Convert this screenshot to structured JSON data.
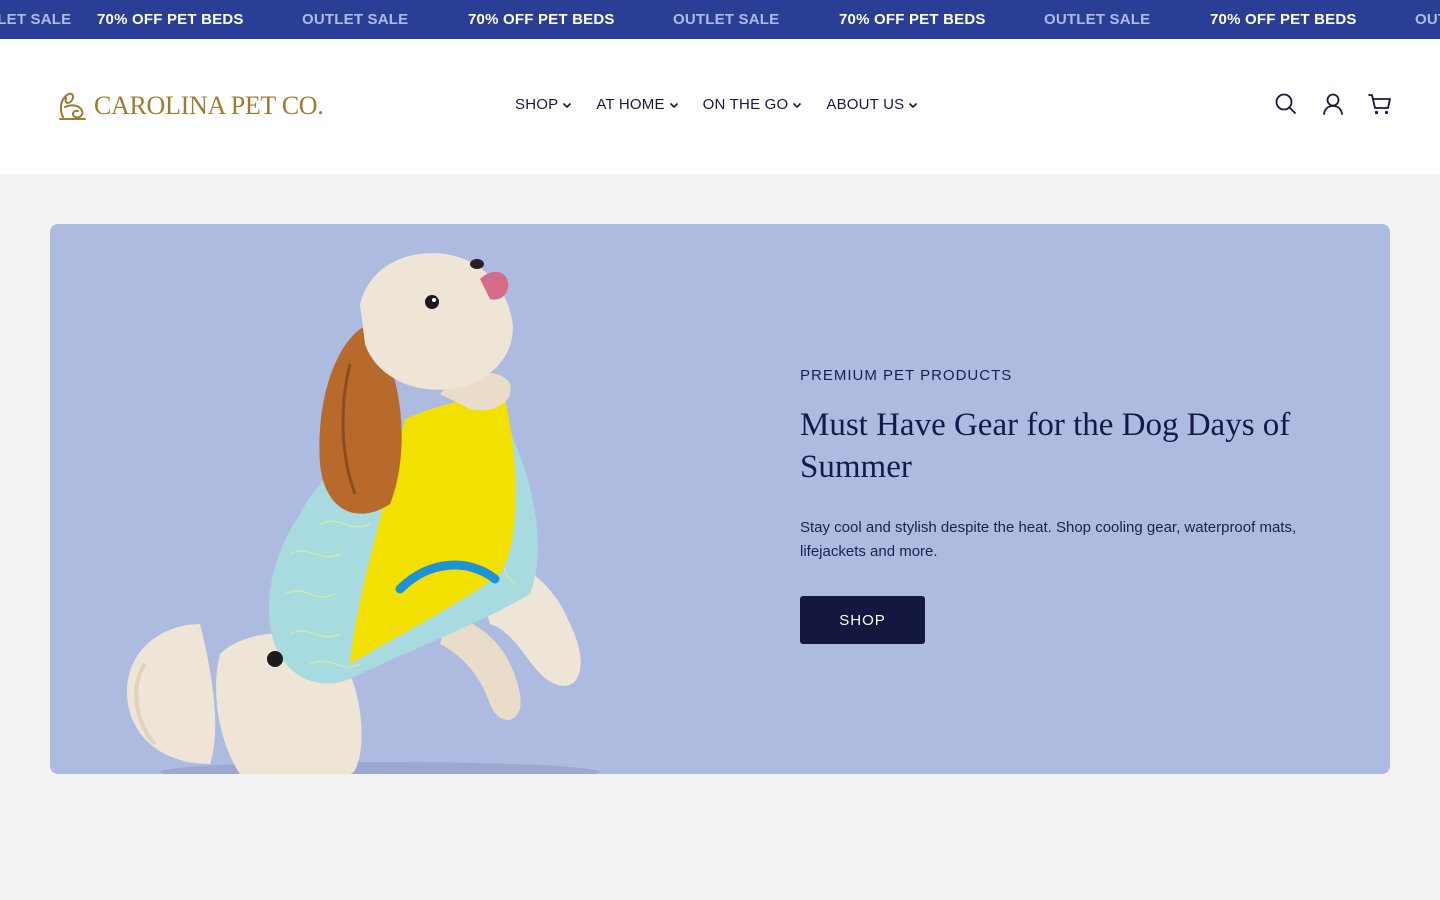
{
  "announcement": {
    "items": [
      {
        "text": "OUTLET SALE",
        "style": "dim"
      },
      {
        "text": "70% OFF PET BEDS",
        "style": "bright"
      },
      {
        "text": "OUTLET SALE",
        "style": "dim"
      },
      {
        "text": "70% OFF PET BEDS",
        "style": "bright"
      },
      {
        "text": "OUTLET SALE",
        "style": "dim"
      },
      {
        "text": "70% OFF PET BEDS",
        "style": "bright"
      },
      {
        "text": "OUTLET SALE",
        "style": "dim"
      },
      {
        "text": "70% OFF PET BEDS",
        "style": "bright"
      },
      {
        "text": "OUTLET SALE",
        "style": "dim"
      }
    ],
    "background": "#2b3e95"
  },
  "header": {
    "logo_text": "CAROLINA PET CO.",
    "logo_color": "#a07b2e",
    "nav": [
      {
        "label": "SHOP",
        "icon": "chevron-down-icon"
      },
      {
        "label": "AT HOME",
        "icon": "chevron-down-icon"
      },
      {
        "label": "ON THE GO",
        "icon": "chevron-down-icon"
      },
      {
        "label": "ABOUT US",
        "icon": "chevron-down-icon"
      }
    ],
    "icons": [
      "search-icon",
      "account-icon",
      "cart-icon"
    ]
  },
  "hero": {
    "eyebrow": "PREMIUM PET PRODUCTS",
    "title": "Must Have Gear for the Dog Days of Summer",
    "description": "Stay cool and stylish despite the heat. Shop cooling gear, waterproof mats, lifejackets and more.",
    "button_label": "SHOP",
    "background": "#aebbe0",
    "button_color": "#14173e"
  }
}
